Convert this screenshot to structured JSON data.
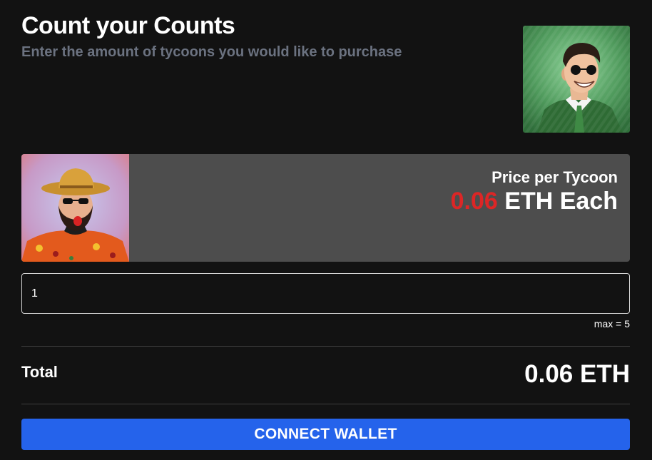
{
  "header": {
    "title": "Count your Counts",
    "subtitle": "Enter the amount of tycoons you would like to purchase"
  },
  "images": {
    "hero_avatar": "tycoon-avatar-green-suit",
    "card_avatar": "tycoon-avatar-cowboy-hat"
  },
  "price": {
    "label": "Price per Tycoon",
    "amount": "0.06",
    "unit": "ETH Each"
  },
  "quantity": {
    "value": "1",
    "max_note": "max = 5"
  },
  "total": {
    "label": "Total",
    "value": "0.06 ETH"
  },
  "actions": {
    "connect_label": "CONNECT WALLET"
  },
  "colors": {
    "background": "#121212",
    "card": "#4d4d4d",
    "accent_red": "#dc2626",
    "button_blue": "#2563eb",
    "subtitle_gray": "#6b7280"
  }
}
